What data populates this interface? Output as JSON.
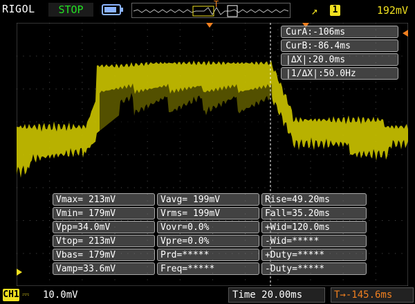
{
  "header": {
    "brand": "RIGOL",
    "run_state": "STOP",
    "trigger_edge_icon": "rising-edge-icon",
    "trigger_channel": "1",
    "trigger_level": "192mV",
    "trigger_marker": "T"
  },
  "battery": {
    "level": 0.85
  },
  "colors": {
    "trace": "#c8c000",
    "accent": "#f08020",
    "channel1": "#f0e020",
    "run_state": "#22e022"
  },
  "cursor_panel": {
    "cur_a": "CurA:-106ms",
    "cur_b": "CurB:-86.4ms",
    "delta_x": "|ΔX|:20.0ms",
    "inv_delta_x": "|1/ΔX|:50.0Hz"
  },
  "measurements": [
    [
      "Vmax= 213mV",
      "Vavg= 199mV",
      "Rise=49.20ms"
    ],
    [
      "Vmin= 179mV",
      "Vrms= 199mV",
      "Fall=35.20ms"
    ],
    [
      "Vpp=34.0mV",
      "Vovr=0.0%",
      "+Wid=120.0ms"
    ],
    [
      "Vtop= 213mV",
      "Vpre=0.0%",
      "-Wid=*****"
    ],
    [
      "Vbas= 179mV",
      "Prd=*****",
      "+Duty=*****"
    ],
    [
      "Vamp=33.6mV",
      "Freq=*****",
      "-Duty=*****"
    ]
  ],
  "footer": {
    "channel": "CH1",
    "vscale": "10.0mV",
    "timebase": "Time 20.00ms",
    "trigger_position": "-145.6ms"
  }
}
